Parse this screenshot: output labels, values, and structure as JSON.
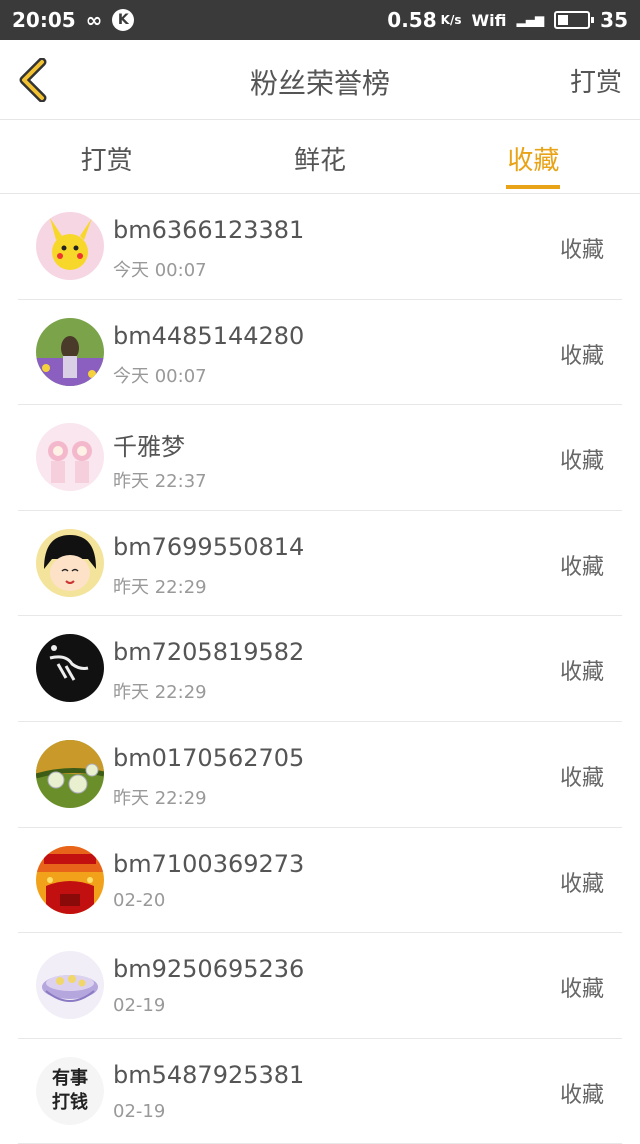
{
  "status": {
    "time": "20:05",
    "k_badge": "K",
    "speed": "0.58",
    "speed_unit": "K/s",
    "wifi": "Wifi",
    "battery": "35",
    "battery_level": 0.35
  },
  "header": {
    "title": "粉丝荣誉榜",
    "action": "打赏"
  },
  "tabs": [
    {
      "label": "打赏",
      "active": false
    },
    {
      "label": "鲜花",
      "active": false
    },
    {
      "label": "收藏",
      "active": true
    }
  ],
  "fans": [
    {
      "name": "bm6366123381",
      "time": "今天 00:07",
      "tag": "收藏",
      "avatar": "pikachu-avatar"
    },
    {
      "name": "bm4485144280",
      "time": "今天 00:07",
      "tag": "收藏",
      "avatar": "girl-field-avatar"
    },
    {
      "name": "千雅梦",
      "time": "昨天 22:37",
      "tag": "收藏",
      "avatar": "anime-pink-avatar"
    },
    {
      "name": "bm7699550814",
      "time": "昨天 22:29",
      "tag": "收藏",
      "avatar": "cartoon-girl-avatar"
    },
    {
      "name": "bm7205819582",
      "time": "昨天 22:29",
      "tag": "收藏",
      "avatar": "black-hand-avatar"
    },
    {
      "name": "bm0170562705",
      "time": "昨天 22:29",
      "tag": "收藏",
      "avatar": "dewdrops-avatar"
    },
    {
      "name": "bm7100369273",
      "time": "02-20",
      "tag": "收藏",
      "avatar": "new-year-avatar"
    },
    {
      "name": "bm9250695236",
      "time": "02-19",
      "tag": "收藏",
      "avatar": "crystal-bowl-avatar"
    },
    {
      "name": "bm5487925381",
      "time": "02-19",
      "tag": "收藏",
      "avatar": "text-avatar",
      "avatar_text": [
        "有事",
        "打钱"
      ]
    }
  ]
}
